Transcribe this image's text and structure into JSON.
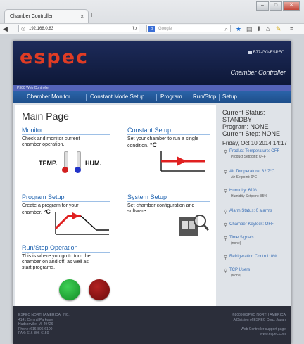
{
  "browser": {
    "tab_title": "Chamber Controller",
    "tab_close": "×",
    "new_tab": "+",
    "url": "192.168.0.83",
    "search_placeholder": "Google"
  },
  "window_buttons": {
    "minimize": "–",
    "maximize": "□",
    "close": "✕"
  },
  "header": {
    "logo": "espec",
    "device_id": "B77-GO-ESPEC",
    "app_title": "Chamber Controller",
    "subtitle": "P300 Web Controller"
  },
  "menu": {
    "items": [
      "Chamber Monitor",
      "Constant Mode Setup",
      "Program",
      "Run/Stop",
      "Setup"
    ]
  },
  "main": {
    "title": "Main Page",
    "monitor": {
      "title": "Monitor",
      "desc1": "Check and monitor current",
      "desc2": "chamber operation.",
      "temp_label": "TEMP.",
      "hum_label": "HUM."
    },
    "constant": {
      "title": "Constant Setup",
      "desc1": "Set your chamber to run a single",
      "desc2": "condition.",
      "unit": "°C"
    },
    "program": {
      "title": "Program Setup",
      "desc1": "Create a program for your",
      "desc2": "chamber.",
      "unit": "°C"
    },
    "system": {
      "title": "System Setup",
      "desc1": "Set chamber configuration and",
      "desc2": "software."
    },
    "runstop": {
      "title": "Run/Stop Operation",
      "desc1": "This is where you go to turn the",
      "desc2": "chamber on and off, as well as",
      "desc3": "start programs."
    }
  },
  "status": {
    "current_status_label": "Current Status:",
    "current_status_value": "STANDBY",
    "program": "Program: NONE",
    "step": "Current Step: NONE",
    "datetime": "Friday, Oct 10 2014 14:17",
    "items": [
      {
        "a": "Product Temperature: OFF",
        "b": "Product Setpoint: OFF"
      },
      {
        "a": "Air Temperature: 32.7°C",
        "b": "Air Setpoint: 0°C"
      },
      {
        "a": "Humidity: 61%",
        "b": "Humidity Setpoint: 85%"
      },
      {
        "a": "Alarm Status: 0 alarms",
        "b": ""
      },
      {
        "a": "Chamber Keylock: OFF",
        "b": ""
      },
      {
        "a": "Time Signals",
        "b": "(none)"
      },
      {
        "a": "Refrigeration Control: 0%",
        "b": ""
      },
      {
        "a": "TCP Users",
        "b": "(None)"
      }
    ]
  },
  "footer": {
    "left": [
      "ESPEC NORTH AMERICA, INC.",
      "4141 Central Parkway",
      "Hudsonville, MI 49426",
      "Phone: 616-896-6100",
      "FAX: 616-896-6150"
    ],
    "right": [
      "©2009 ESPEC NORTH AMERICA",
      "A Division of ESPEC Corp, Japan"
    ],
    "right2": [
      "Web Controller support page",
      "www.espec.com"
    ]
  },
  "colors": {
    "header": "#1d2b5a",
    "menu": "#2a63a8",
    "accent": "#1f63b0",
    "logo": "#e03c24",
    "run": "#1f9c2f",
    "stop": "#8f1010"
  }
}
